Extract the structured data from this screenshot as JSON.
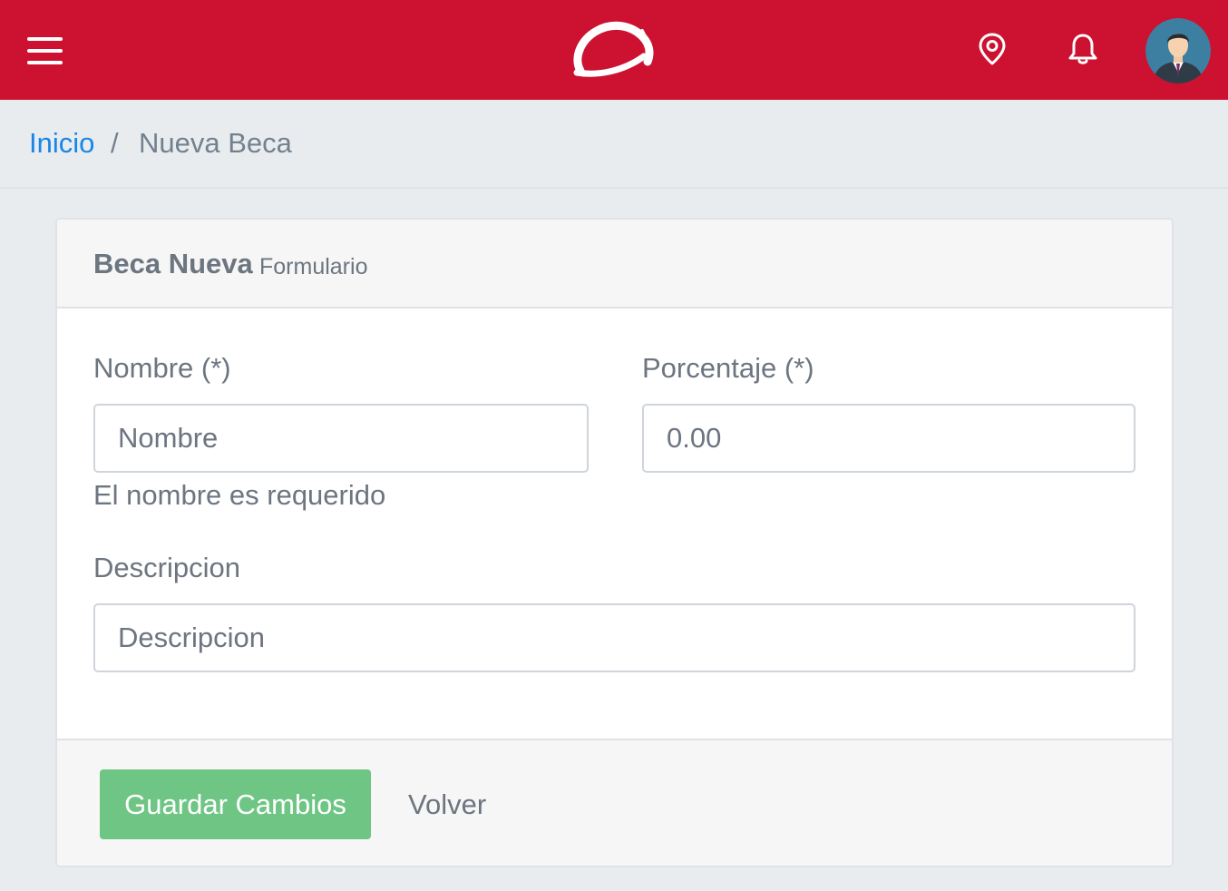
{
  "header": {
    "menu_icon": "hamburger-menu-icon",
    "logo_icon": "brand-logo",
    "location_icon": "map-pin-icon",
    "notification_icon": "bell-icon",
    "avatar_icon": "user-avatar",
    "brand_color": "#cc1230"
  },
  "breadcrumb": {
    "home": "Inicio",
    "separator": "/",
    "current": "Nueva Beca"
  },
  "card": {
    "title": "Beca Nueva",
    "subtitle": "Formulario"
  },
  "form": {
    "nombre": {
      "label": "Nombre (*)",
      "placeholder": "Nombre",
      "value": "",
      "error": "El nombre es requerido"
    },
    "porcentaje": {
      "label": "Porcentaje (*)",
      "placeholder": "0.00",
      "value": ""
    },
    "descripcion": {
      "label": "Descripcion",
      "placeholder": "Descripcion",
      "value": ""
    }
  },
  "footer": {
    "save_label": "Guardar Cambios",
    "back_label": "Volver",
    "save_color": "#6ec584"
  }
}
